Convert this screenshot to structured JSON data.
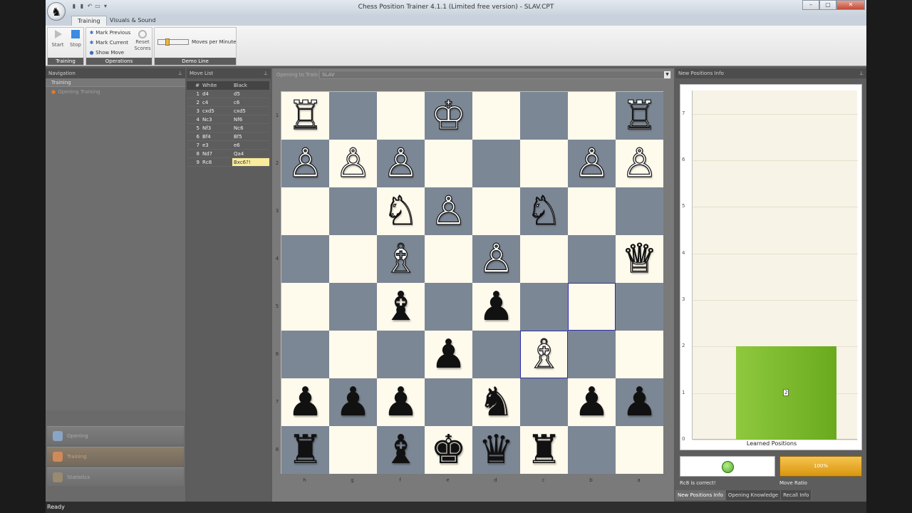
{
  "window": {
    "title": "Chess Position Trainer 4.1.1 (Limited free version) - SLAV.CPT",
    "app_icon": "knight-icon"
  },
  "ribbon": {
    "tabs": [
      "Training",
      "Visuals & Sound"
    ],
    "active_tab": "Training",
    "training_group": {
      "label": "Training",
      "start": "Start",
      "stop": "Stop"
    },
    "operations_group": {
      "label": "Operations",
      "mark_previous": "Mark Previous",
      "mark_current": "Mark Current",
      "show_move": "Show Move",
      "reset": "Reset",
      "scores": "Scores"
    },
    "demo_group": {
      "label": "Demo Line",
      "moves_per_minute": "Moves per Minute",
      "slider_level": 0.25
    }
  },
  "navigation": {
    "header": "Navigation",
    "section": "Training",
    "item": "Opening Training",
    "buttons": [
      "Opening",
      "Training",
      "Statistics"
    ],
    "selected_button": "Training"
  },
  "move_list": {
    "header": "Move List",
    "columns": [
      "#",
      "White",
      "Black"
    ],
    "rows": [
      {
        "n": "1",
        "w": "d4",
        "b": "d5"
      },
      {
        "n": "2",
        "w": "c4",
        "b": "c6"
      },
      {
        "n": "3",
        "w": "cxd5",
        "b": "cxd5"
      },
      {
        "n": "4",
        "w": "Nc3",
        "b": "Nf6"
      },
      {
        "n": "5",
        "w": "Nf3",
        "b": "Nc6"
      },
      {
        "n": "6",
        "w": "Bf4",
        "b": "Bf5"
      },
      {
        "n": "7",
        "w": "e3",
        "b": "e6"
      },
      {
        "n": "8",
        "w": "Nd7",
        "b": "Qa4"
      },
      {
        "n": "9",
        "w": "Rc8",
        "b": "Bxc6?!"
      }
    ]
  },
  "board": {
    "opening_label": "Opening to Train:",
    "opening_value": "SLAV",
    "ranks": [
      "1",
      "2",
      "3",
      "4",
      "5",
      "6",
      "7",
      "8"
    ],
    "files": [
      "h",
      "g",
      "f",
      "e",
      "d",
      "c",
      "b",
      "a"
    ],
    "highlight_squares": [
      [
        4,
        6
      ],
      [
        5,
        5
      ]
    ],
    "pieces": [
      {
        "r": 0,
        "c": 0,
        "p": "♖",
        "w": true
      },
      {
        "r": 0,
        "c": 3,
        "p": "♔",
        "w": true
      },
      {
        "r": 0,
        "c": 7,
        "p": "♖",
        "w": true
      },
      {
        "r": 1,
        "c": 0,
        "p": "♙",
        "w": true
      },
      {
        "r": 1,
        "c": 1,
        "p": "♙",
        "w": true
      },
      {
        "r": 1,
        "c": 2,
        "p": "♙",
        "w": true
      },
      {
        "r": 1,
        "c": 6,
        "p": "♙",
        "w": true
      },
      {
        "r": 1,
        "c": 7,
        "p": "♙",
        "w": true
      },
      {
        "r": 2,
        "c": 2,
        "p": "♘",
        "w": true
      },
      {
        "r": 2,
        "c": 3,
        "p": "♙",
        "w": true
      },
      {
        "r": 2,
        "c": 5,
        "p": "♘",
        "w": true
      },
      {
        "r": 3,
        "c": 2,
        "p": "♗",
        "w": true
      },
      {
        "r": 3,
        "c": 4,
        "p": "♙",
        "w": true
      },
      {
        "r": 3,
        "c": 7,
        "p": "♕",
        "w": true
      },
      {
        "r": 4,
        "c": 2,
        "p": "♝",
        "w": false
      },
      {
        "r": 4,
        "c": 4,
        "p": "♟",
        "w": false
      },
      {
        "r": 5,
        "c": 3,
        "p": "♟",
        "w": false
      },
      {
        "r": 5,
        "c": 5,
        "p": "♗",
        "w": true
      },
      {
        "r": 6,
        "c": 0,
        "p": "♟",
        "w": false
      },
      {
        "r": 6,
        "c": 1,
        "p": "♟",
        "w": false
      },
      {
        "r": 6,
        "c": 2,
        "p": "♟",
        "w": false
      },
      {
        "r": 6,
        "c": 4,
        "p": "♞",
        "w": false
      },
      {
        "r": 6,
        "c": 6,
        "p": "♟",
        "w": false
      },
      {
        "r": 6,
        "c": 7,
        "p": "♟",
        "w": false
      },
      {
        "r": 7,
        "c": 0,
        "p": "♜",
        "w": false
      },
      {
        "r": 7,
        "c": 2,
        "p": "♝",
        "w": false
      },
      {
        "r": 7,
        "c": 3,
        "p": "♚",
        "w": false
      },
      {
        "r": 7,
        "c": 4,
        "p": "♛",
        "w": false
      },
      {
        "r": 7,
        "c": 5,
        "p": "♜",
        "w": false
      }
    ]
  },
  "info_panel": {
    "header": "New Positions Info",
    "status_message": "Rc8   is correct!",
    "move_ratio_value": "100%",
    "move_ratio_label": "Move Ratio",
    "tabs": [
      "New Positions Info",
      "Opening Knowledge",
      "Recall Info"
    ],
    "active_tab": "New Positions Info"
  },
  "chart_data": {
    "type": "bar",
    "categories": [
      "Learned Positions"
    ],
    "values": [
      2
    ],
    "data_labels": [
      "2"
    ],
    "xlabel": "Learned Positions",
    "ylim": [
      0,
      7.5
    ],
    "yticks": [
      "0",
      "1",
      "2",
      "3",
      "4",
      "5",
      "6",
      "7"
    ],
    "grid": true,
    "bar_color": "#7aba2c"
  },
  "statusbar": {
    "text": "Ready"
  }
}
